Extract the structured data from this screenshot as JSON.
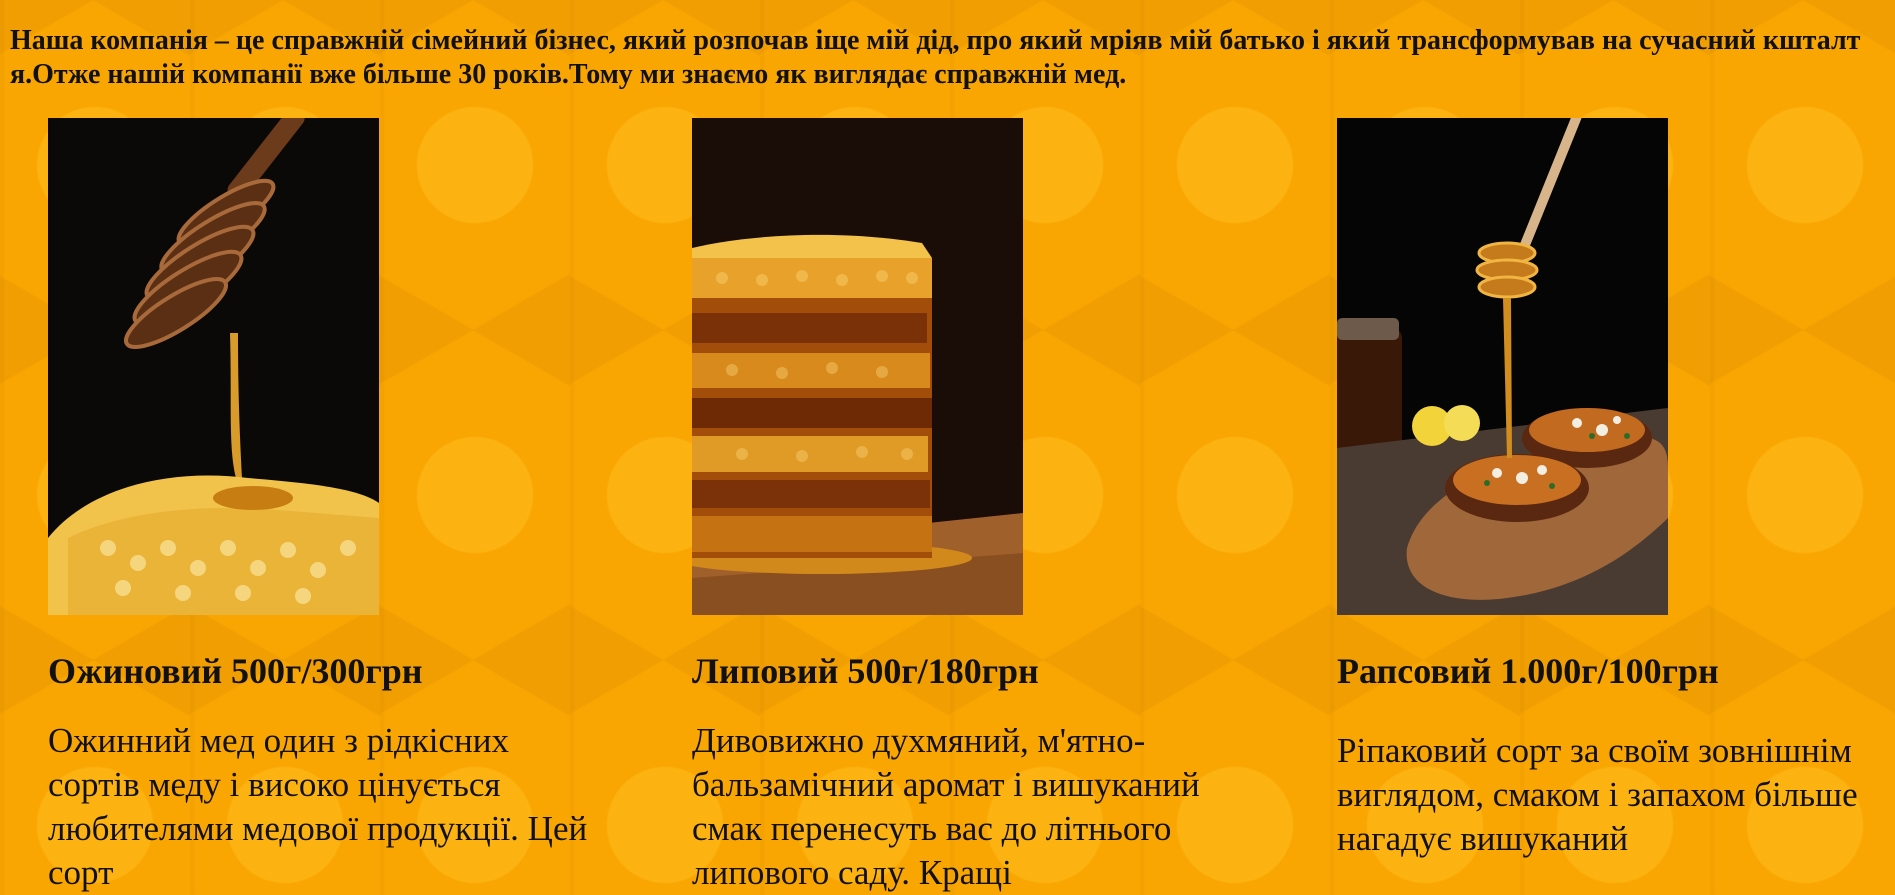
{
  "intro": "Наша компанія – це справжній сімейний бізнес, який розпочав іще мій дід, про який мріяв мій батько і який трансформував на сучасний кшталт я.Отже нашій компанії вже більше 30 років.Тому ми знаємо як виглядає справжній мед.",
  "products": [
    {
      "title": "Ожиновий 500г/300грн",
      "description": "Ожинний мед один з рідкісних сортів меду і високо цінується любителями медової продукції. Цей сорт",
      "image_alt": "honey dipper over honeycomb"
    },
    {
      "title": "Липовий 500г/180грн",
      "description": "Дивовижно духмяний, м'ятно-бальзамічний аромат і вишуканий смак перенесуть вас до літнього липового саду. Кращі",
      "image_alt": "stacked honeycomb on wooden board"
    },
    {
      "title": "Рапсовий 1.000г/100грн",
      "description": "Ріпаковий сорт за своїм зовнішнім виглядом, смаком і запахом більше нагадує вишуканий",
      "image_alt": "honey dipper over roasted dish"
    }
  ],
  "colors": {
    "background": "#f9a602",
    "text": "#111111"
  }
}
